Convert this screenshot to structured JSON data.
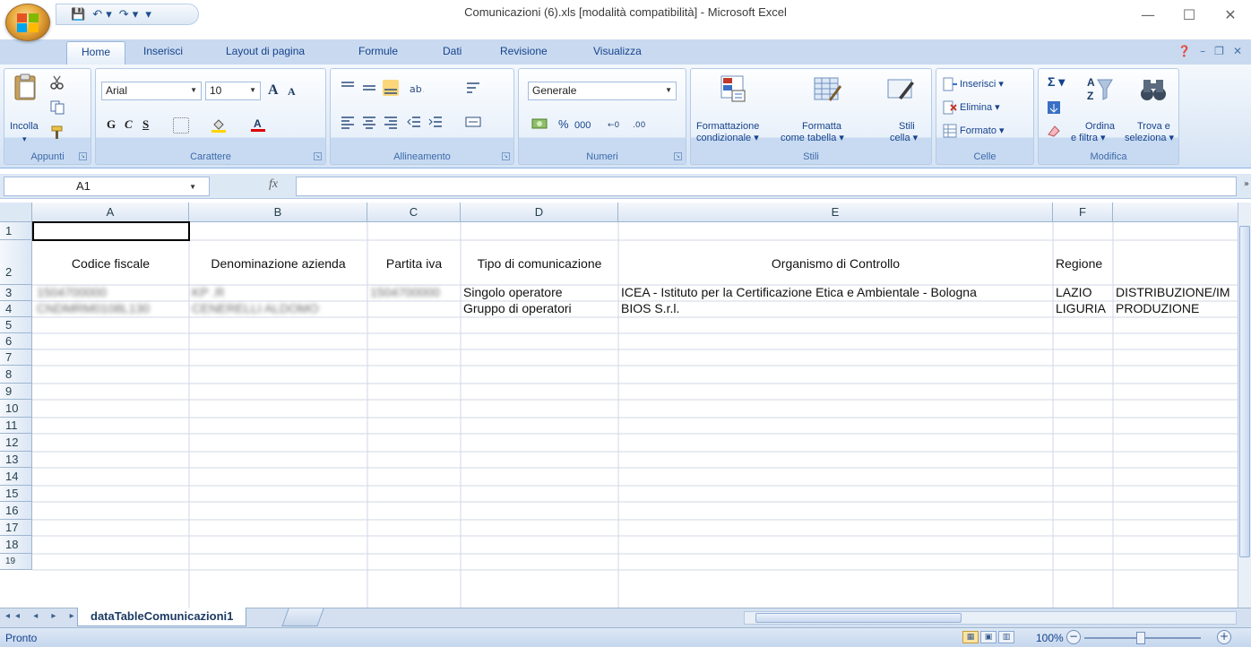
{
  "window": {
    "title": "Comunicazioni (6).xls  [modalità compatibilità] - Microsoft Excel",
    "minimize": "—",
    "maximize": "☐",
    "close": "✕"
  },
  "qat": {
    "save": "💾",
    "undo": "↶ ▾",
    "redo": "↷ ▾",
    "customize": "▾"
  },
  "tabs": [
    {
      "label": "Home"
    },
    {
      "label": "Inserisci"
    },
    {
      "label": "Layout di pagina"
    },
    {
      "label": "Formule"
    },
    {
      "label": "Dati"
    },
    {
      "label": "Revisione"
    },
    {
      "label": "Visualizza"
    }
  ],
  "ribbon": {
    "appunti": {
      "label": "Appunti",
      "paste": "Incolla"
    },
    "carattere": {
      "label": "Carattere",
      "font": "Arial",
      "size": "10",
      "bold": "G",
      "italic": "C",
      "underline": "S",
      "grow": "A",
      "shrink": "A"
    },
    "allineamento": {
      "label": "Allineamento"
    },
    "numeri": {
      "label": "Numeri",
      "format": "Generale",
      "percent": "%",
      "thousands": "000"
    },
    "stili": {
      "label": "Stili",
      "cond1": "Formattazione",
      "cond2": "condizionale ▾",
      "table1": "Formatta",
      "table2": "come tabella ▾",
      "cell1": "Stili",
      "cell2": "cella ▾"
    },
    "celle": {
      "label": "Celle",
      "insert": "Inserisci ▾",
      "delete": "Elimina ▾",
      "format": "Formato ▾"
    },
    "modifica": {
      "label": "Modifica",
      "sum": "Σ ▾",
      "sort1": "Ordina",
      "sort2": "e filtra ▾",
      "find1": "Trova e",
      "find2": "seleziona ▾"
    }
  },
  "formula_bar": {
    "name_box": "A1",
    "fx": "fx",
    "value": ""
  },
  "columns": [
    {
      "letter": "A"
    },
    {
      "letter": "B"
    },
    {
      "letter": "C"
    },
    {
      "letter": "D"
    },
    {
      "letter": "E"
    },
    {
      "letter": "F"
    },
    {
      "letter": ""
    }
  ],
  "rows": [
    "1",
    "2",
    "3",
    "4",
    "5",
    "6",
    "7",
    "8",
    "9",
    "10",
    "11",
    "12",
    "13",
    "14",
    "15",
    "16",
    "17",
    "18",
    "19"
  ],
  "cells": {
    "header": {
      "a": "Codice fiscale",
      "b": "Denominazione azienda",
      "c": "Partita iva",
      "d": "Tipo di comunicazione",
      "e": "Organismo di Controllo",
      "f": "Regione"
    },
    "r3": {
      "a": "1504700000",
      "b": "KP                                    .R",
      "c": "1504700000",
      "d": "Singolo operatore",
      "e": "ICEA - Istituto per la Certificazione Etica e Ambientale - Bologna",
      "f": "LAZIO",
      "g": "DISTRIBUZIONE/IM"
    },
    "r4": {
      "a": "CNDMRM0108L130",
      "b": "CENERELLI ALDOMO",
      "c": "",
      "d": "Gruppo di operatori",
      "e": "BIOS S.r.l.",
      "f": "LIGURIA",
      "g": "PRODUZIONE"
    }
  },
  "sheet": {
    "name": "dataTableComunicazioni1",
    "nav": "◂◂ ◂ ▸ ▸▸"
  },
  "status": {
    "text": "Pronto",
    "zoom": "100%",
    "minus": "−",
    "plus": "+"
  },
  "colors": {
    "accent": "#15428b",
    "ribbon": "#dbe7f5",
    "office_orange": "#e8a93b"
  }
}
